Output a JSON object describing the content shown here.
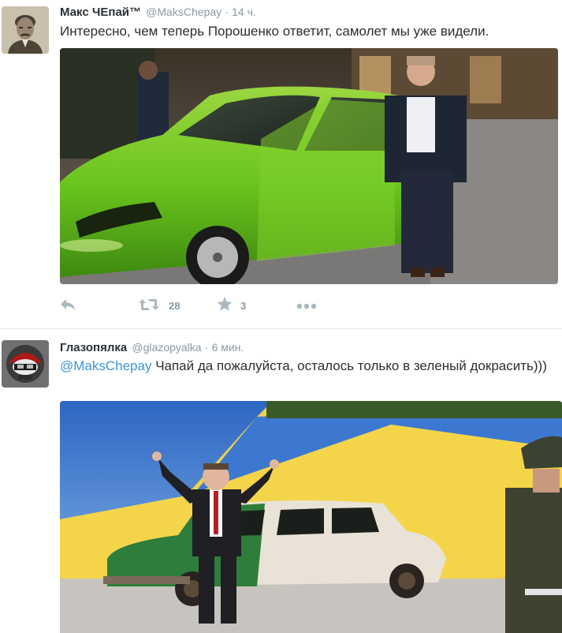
{
  "tweets": [
    {
      "fullname": "Макс ЧЕпай™",
      "username": "@MaksChepay",
      "separator": "·",
      "time": "14 ч.",
      "text": "Интересно, чем теперь Порошенко ответит, самолет мы уже видели.",
      "actions": {
        "retweets": "28",
        "favorites": "3"
      }
    },
    {
      "fullname": "Глазопялка",
      "username": "@glazopyalka",
      "separator": "·",
      "time": "6 мин.",
      "mention": "@MaksChepay",
      "text": " Чапай да пожалуйста, осталось только в зеленый докрасить)))"
    }
  ],
  "colors": {
    "link": "#3b94d9",
    "meta": "#8899a6",
    "action_icon": "#aab8c2",
    "separator_line": "#e1e8ed"
  },
  "icons": {
    "reply": "reply-icon",
    "retweet": "retweet-icon",
    "favorite": "star-icon",
    "more": "more-dots-icon"
  }
}
